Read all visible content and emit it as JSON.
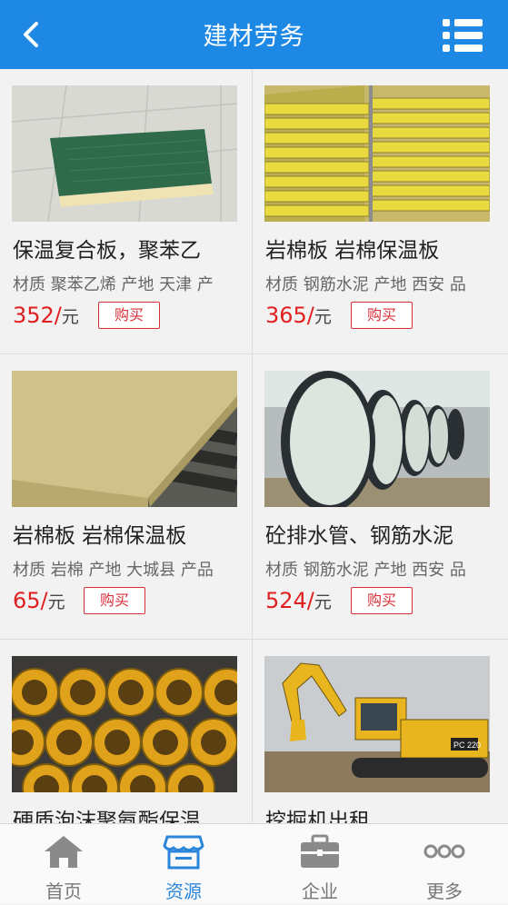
{
  "header": {
    "title": "建材劳务"
  },
  "products": [
    {
      "name": "保温复合板，聚苯乙",
      "desc": "材质 聚苯乙烯 产地 天津 产",
      "price": "352/",
      "unit": "元",
      "buy": "购买"
    },
    {
      "name": "岩棉板 岩棉保温板",
      "desc": "材质 钢筋水泥 产地 西安 品",
      "price": "365/",
      "unit": "元",
      "buy": "购买"
    },
    {
      "name": "岩棉板 岩棉保温板",
      "desc": "材质 岩棉 产地 大城县 产品",
      "price": "65/",
      "unit": "元",
      "buy": "购买"
    },
    {
      "name": "砼排水管、钢筋水泥",
      "desc": "材质 钢筋水泥 产地 西安 品",
      "price": "524/",
      "unit": "元",
      "buy": "购买"
    },
    {
      "name": "硬质泡沫聚氨酯保温",
      "desc": "",
      "price": "",
      "unit": "",
      "buy": ""
    },
    {
      "name": "挖掘机出租",
      "desc": "",
      "price": "",
      "unit": "",
      "buy": ""
    }
  ],
  "tabs": [
    {
      "label": "首页",
      "icon": "home-icon"
    },
    {
      "label": "资源",
      "icon": "store-icon"
    },
    {
      "label": "企业",
      "icon": "briefcase-icon"
    },
    {
      "label": "更多",
      "icon": "more-icon"
    }
  ],
  "colors": {
    "header": "#1e88e5",
    "price": "#e02020",
    "active_tab": "#2b86d9"
  }
}
